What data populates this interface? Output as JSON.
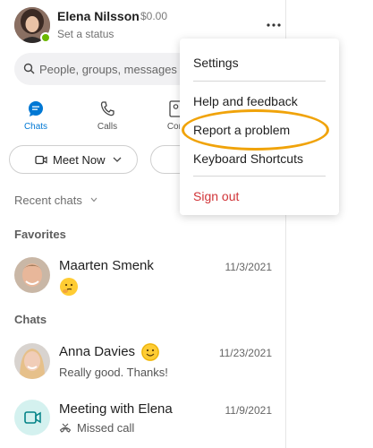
{
  "profile": {
    "name": "Elena Nilsson",
    "credit": "$0.00",
    "status": "Set a status",
    "presence_color": "#6bb700"
  },
  "search": {
    "placeholder": "People, groups, messages"
  },
  "tabs": [
    {
      "label": "Chats",
      "icon": "chat-bubble-icon",
      "active": true
    },
    {
      "label": "Calls",
      "icon": "phone-icon",
      "active": false
    },
    {
      "label": "Con",
      "icon": "contacts-icon",
      "active": false
    }
  ],
  "actions": {
    "meet_now_label": "Meet Now"
  },
  "sections": {
    "recent": "Recent chats",
    "favorites": "Favorites",
    "chats": "Chats"
  },
  "favorites": [
    {
      "name": "Maarten Smenk",
      "date": "11/3/2021",
      "sub_emoji": "thinking-face"
    }
  ],
  "chats": [
    {
      "name": "Anna Davies",
      "date": "11/23/2021",
      "preview": "Really good. Thanks!",
      "name_emoji": "smiling-face"
    },
    {
      "name": "Meeting with Elena",
      "date": "11/9/2021",
      "preview": "Missed call",
      "preview_icon": "missed-call-icon"
    }
  ],
  "menu": {
    "items": [
      "Settings",
      "Help and feedback",
      "Report a problem",
      "Keyboard Shortcuts",
      "Sign out"
    ],
    "highlighted": "Report a problem",
    "signout_color": "#d13438",
    "highlight_color": "#f0a30a"
  },
  "colors": {
    "accent": "#0078d4",
    "meeting_avatar_bg": "#d4f1ef",
    "meeting_avatar_fg": "#038387"
  }
}
